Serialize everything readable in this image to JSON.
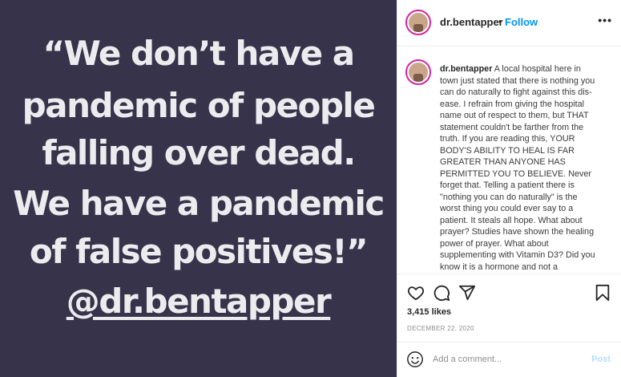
{
  "post": {
    "quote_lines": [
      "“We don’t have a",
      "pandemic of people",
      "falling over dead.",
      "We have a pandemic",
      "of false positives!”",
      "@dr.bentapper"
    ]
  },
  "header": {
    "username": "dr.bentapper",
    "separator": "•",
    "follow_label": "Follow",
    "more_label": "•••"
  },
  "caption": {
    "username": "dr.bentapper",
    "text": " A local hospital here in town just stated that there is nothing you can do naturally to fight against this dis-ease. I refrain from giving the hospital name out of respect to them, but THAT statement couldn't be farther from the truth. If you are reading this, YOUR BODY'S ABILITY TO HEAL IS FAR GREATER THAN ANYONE HAS PERMITTED YOU TO BELIEVE. Never forget that. Telling a patient there is \"nothing you can do naturally\" is the worst thing you could ever say to a patient. It steals all hope. What about prayer? Studies have shown the healing power of prayer. What about supplementing with Vitamin D3? Did you know it is a hormone and not a"
  },
  "engagement": {
    "likes": "3,415 likes",
    "date": "DECEMBER 22, 2020"
  },
  "comment": {
    "placeholder": "Add a comment...",
    "post_label": "Post"
  },
  "icons": {
    "like": "heart-icon",
    "comment": "comment-bubble-icon",
    "share": "paper-plane-icon",
    "save": "bookmark-icon",
    "emoji": "smiley-icon"
  },
  "colors": {
    "image_background": "#37334a",
    "quote_text": "#ececef",
    "follow": "#0095f6",
    "post_disabled": "#b2dffc"
  }
}
